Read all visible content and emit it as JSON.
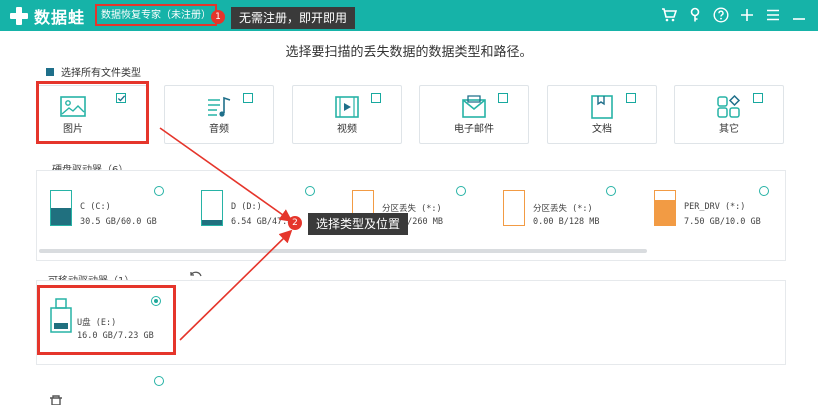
{
  "app": {
    "name": "数据蛙",
    "subtitle": "数据恢复专家（未注册）"
  },
  "callouts": [
    {
      "num": "1",
      "text": "无需注册，即开即用"
    },
    {
      "num": "2",
      "text": "选择类型及位置"
    }
  ],
  "main_title": "选择要扫描的丢失数据的数据类型和路径。",
  "select_all_label": "选择所有文件类型",
  "file_types": [
    {
      "label": "图片",
      "icon": "image-icon",
      "checked": true
    },
    {
      "label": "音频",
      "icon": "audio-icon",
      "checked": false
    },
    {
      "label": "视频",
      "icon": "video-icon",
      "checked": false
    },
    {
      "label": "电子邮件",
      "icon": "email-icon",
      "checked": false
    },
    {
      "label": "文档",
      "icon": "document-icon",
      "checked": false
    },
    {
      "label": "其它",
      "icon": "other-icon",
      "checked": false
    }
  ],
  "hard_drives": {
    "title": "硬盘驱动器（6）",
    "items": [
      {
        "name": "C (C:)",
        "size": "30.5 GB/60.0 GB",
        "fill": 0.51
      },
      {
        "name": "D (D:)",
        "size": "6.54 GB/47.8",
        "fill": 0.14
      },
      {
        "name": "分区丢失 (*:)",
        "size": "B/260 MB",
        "fill": 0
      },
      {
        "name": "分区丢失 (*:)",
        "size": "0.00  B/128 MB",
        "fill": 0
      },
      {
        "name": "PER_DRV (*:)",
        "size": "7.50 GB/10.0 GB",
        "fill": 0.75
      }
    ]
  },
  "removable": {
    "title": "可移动驱动器（1）",
    "items": [
      {
        "name": "U盘 (E:)",
        "size": "16.0 GB/7.23 GB",
        "selected": true
      }
    ]
  },
  "colors": {
    "accent": "#16b3a8",
    "highlight": "#e5352b",
    "drive_fill": "#20707f",
    "orange": "#f29b44"
  }
}
